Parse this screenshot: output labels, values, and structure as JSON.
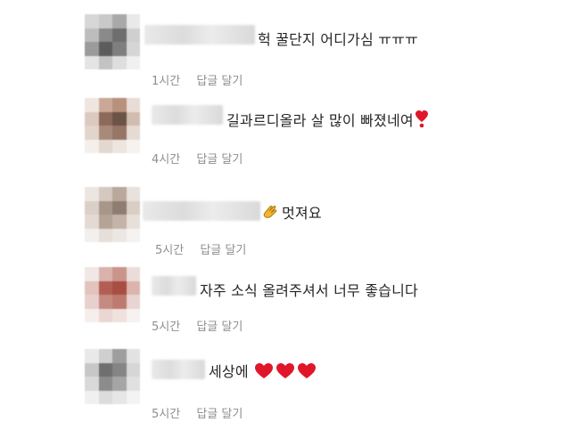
{
  "comments": [
    {
      "text": "헉 꿀단지 어디가심 ㅠㅠㅠ",
      "time": "1시간",
      "reply": "답글 달기",
      "avatar_colors": [
        "#d7d7d7",
        "#c9c9c9",
        "#a9a9a9",
        "#e9e9e9",
        "#bdbdbd",
        "#8a8a8a",
        "#6e6e6e",
        "#cfcfcf",
        "#9b9b9b",
        "#5c5c5c",
        "#7f7f7f",
        "#d5d5d5",
        "#e4e4e4",
        "#c3c3c3",
        "#dedede",
        "#f0f0f0"
      ]
    },
    {
      "text": "길과르디올라 살 많이 빠졌네여",
      "time": "4시간",
      "reply": "답글 달기",
      "trailing_icon": "red-heart-exclamation-icon",
      "avatar_colors": [
        "#efe6e0",
        "#c9a996",
        "#b7917c",
        "#e8ddd6",
        "#dccac0",
        "#8c6a5a",
        "#6b5346",
        "#d1bcb0",
        "#e2d5cc",
        "#a88a7a",
        "#977666",
        "#e6dbd3",
        "#f4efeb",
        "#e3d8d0",
        "#ede5e0",
        "#f6f2ef"
      ]
    },
    {
      "text": "멋져요",
      "time": "5시간",
      "reply": "답글 달기",
      "leading_icon": "clapping-hands-icon",
      "avatar_colors": [
        "#ece6e2",
        "#d5c8bf",
        "#b9a89b",
        "#e8e1dc",
        "#dbd0c8",
        "#a8968a",
        "#8f7d71",
        "#d9cdc4",
        "#e3dad3",
        "#b5a397",
        "#c3b3a8",
        "#e7dfd9",
        "#f3efec",
        "#e6ded8",
        "#ede7e3",
        "#f5f2f0"
      ]
    },
    {
      "text": "자주 소식 올려주셔서 너무 좋습니다",
      "time": "5시간",
      "reply": "답글 달기",
      "avatar_colors": [
        "#f1e7e5",
        "#d9b2ab",
        "#c9948b",
        "#ecdcd9",
        "#e2c3bd",
        "#b35e52",
        "#a84e43",
        "#dcb4ad",
        "#e8d1cc",
        "#c58a80",
        "#bd7b70",
        "#e8d4d0",
        "#f6eeec",
        "#ead6d2",
        "#efe1de",
        "#f7f1f0"
      ]
    },
    {
      "text": "세상에",
      "time": "5시간",
      "reply": "답글 달기",
      "trailing_icon": "red-heart-icon x3",
      "avatar_colors": [
        "#e9e9e9",
        "#cfcfcf",
        "#9e9e9e",
        "#e2e2e2",
        "#c7c7c7",
        "#6f6f6f",
        "#858585",
        "#d6d6d6",
        "#d9d9d9",
        "#8c8c8c",
        "#a5a5a5",
        "#e0e0e0",
        "#f0f0f0",
        "#dcdcdc",
        "#e6e6e6",
        "#f3f3f3"
      ]
    }
  ],
  "colors": {
    "text": "#262626",
    "meta": "#8e8e8e",
    "heart": "#e0162b",
    "clap": "#f2b431"
  }
}
